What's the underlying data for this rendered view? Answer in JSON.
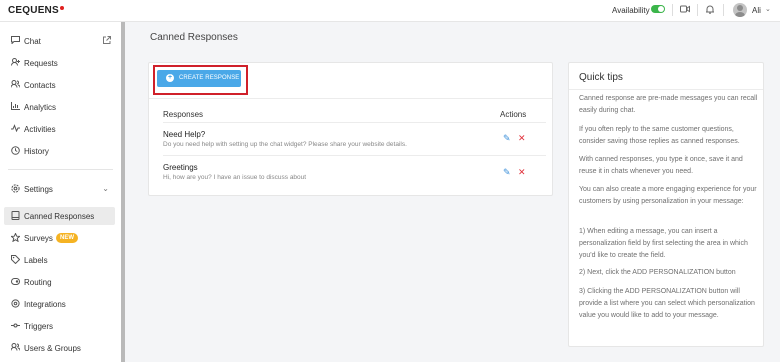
{
  "brand": {
    "name": "CEQUENS"
  },
  "topbar": {
    "availability_label": "Availability",
    "user_name": "Ali",
    "icons": [
      "video-icon",
      "bell-icon",
      "avatar",
      "chevron-down-icon"
    ]
  },
  "sidebar": {
    "chat": "Chat",
    "requests": "Requests",
    "contacts": "Contacts",
    "analytics": "Analytics",
    "activities": "Activities",
    "history": "History",
    "settings": "Settings",
    "canned_responses": "Canned Responses",
    "surveys": "Surveys",
    "surveys_badge": "NEW",
    "labels": "Labels",
    "routing": "Routing",
    "integrations": "Integrations",
    "triggers": "Triggers",
    "users_groups": "Users & Groups"
  },
  "page": {
    "title": "Canned Responses"
  },
  "main": {
    "create_button": "CREATE RESPONSE",
    "columns": {
      "responses": "Responses",
      "actions": "Actions"
    },
    "rows": [
      {
        "title": "Need Help?",
        "text": "Do you need help with setting up the chat widget? Please share your website details."
      },
      {
        "title": "Greetings",
        "text": "Hi, how are you? I have an issue to discuss about"
      }
    ]
  },
  "tips": {
    "title": "Quick tips",
    "paragraphs": [
      "Canned response are pre-made messages you can recall easily during chat.",
      "If you often reply to the same customer questions, consider saving those replies as canned responses.",
      "With canned responses, you type it once, save it and reuse it in chats whenever you need.",
      "You can also create a more engaging experience for your customers by using personalization in your message:",
      "1) When editing a message, you can insert a personalization field by first selecting the area in which you'd like to create the field.",
      "2) Next, click the ADD PERSONALIZATION button",
      "3) Clicking the ADD PERSONALIZATION button will provide a list where you can select which personalization value you would like to add to your message."
    ]
  },
  "colors": {
    "accent": "#4aa8e8",
    "brand_red": "#e0201e",
    "toggle_on": "#3bb54a",
    "badge": "#f5b323",
    "highlight": "#d0202a"
  }
}
